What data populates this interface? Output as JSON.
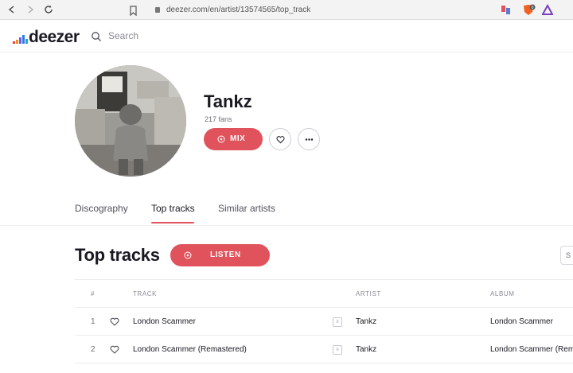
{
  "browser": {
    "url": "deezer.com/en/artist/13574565/top_track"
  },
  "header": {
    "logo_text": "deezer",
    "search_placeholder": "Search"
  },
  "artist": {
    "name": "Tankz",
    "fans": "217 fans",
    "mix_label": "MIX"
  },
  "tabs": [
    {
      "label": "Discography",
      "active": false
    },
    {
      "label": "Top tracks",
      "active": true
    },
    {
      "label": "Similar artists",
      "active": false
    }
  ],
  "section": {
    "title": "Top tracks",
    "listen_label": "LISTEN",
    "side_button_text": "S"
  },
  "table": {
    "headers": {
      "num": "#",
      "track": "TRACK",
      "artist": "ARTIST",
      "album": "ALBUM"
    },
    "rows": [
      {
        "num": "1",
        "track": "London Scammer",
        "artist": "Tankz",
        "album": "London Scammer"
      },
      {
        "num": "2",
        "track": "London Scammer (Remastered)",
        "artist": "Tankz",
        "album": "London Scammer (Rem"
      }
    ]
  },
  "colors": {
    "accent": "#e0525c",
    "text": "#191922",
    "muted": "#8a8a96"
  }
}
